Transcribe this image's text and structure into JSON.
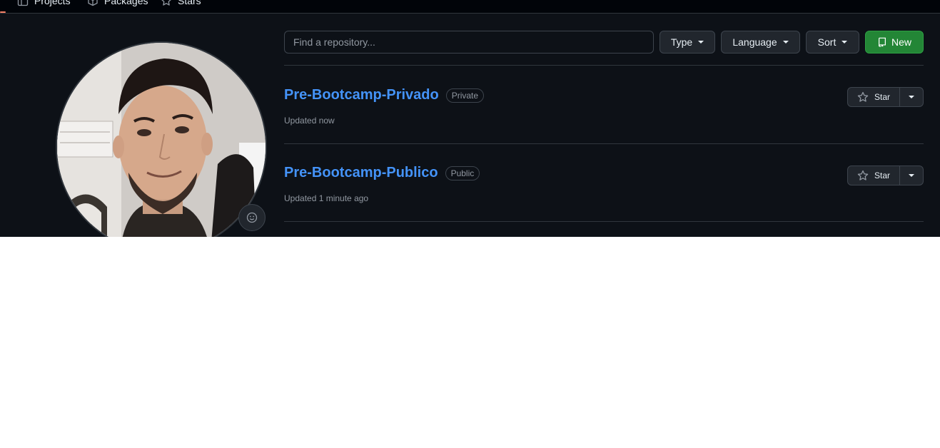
{
  "nav": {
    "items": [
      {
        "label": "Projects",
        "icon": "table-icon"
      },
      {
        "label": "Packages",
        "icon": "package-icon"
      },
      {
        "label": "Stars",
        "icon": "star-icon"
      }
    ]
  },
  "profile": {
    "avatar_alt": "",
    "status_icon": "smiley-icon"
  },
  "filters": {
    "search_placeholder": "Find a repository...",
    "type_label": "Type",
    "language_label": "Language",
    "sort_label": "Sort",
    "new_label": "New"
  },
  "repos": [
    {
      "name": "Pre-Bootcamp-Privado",
      "visibility": "Private",
      "updated": "Updated now",
      "star_label": "Star"
    },
    {
      "name": "Pre-Bootcamp-Publico",
      "visibility": "Public",
      "updated": "Updated 1 minute ago",
      "star_label": "Star"
    }
  ],
  "colors": {
    "background": "#0d1117",
    "link": "#4493f8",
    "new_button": "#238636",
    "border": "#30363d"
  }
}
